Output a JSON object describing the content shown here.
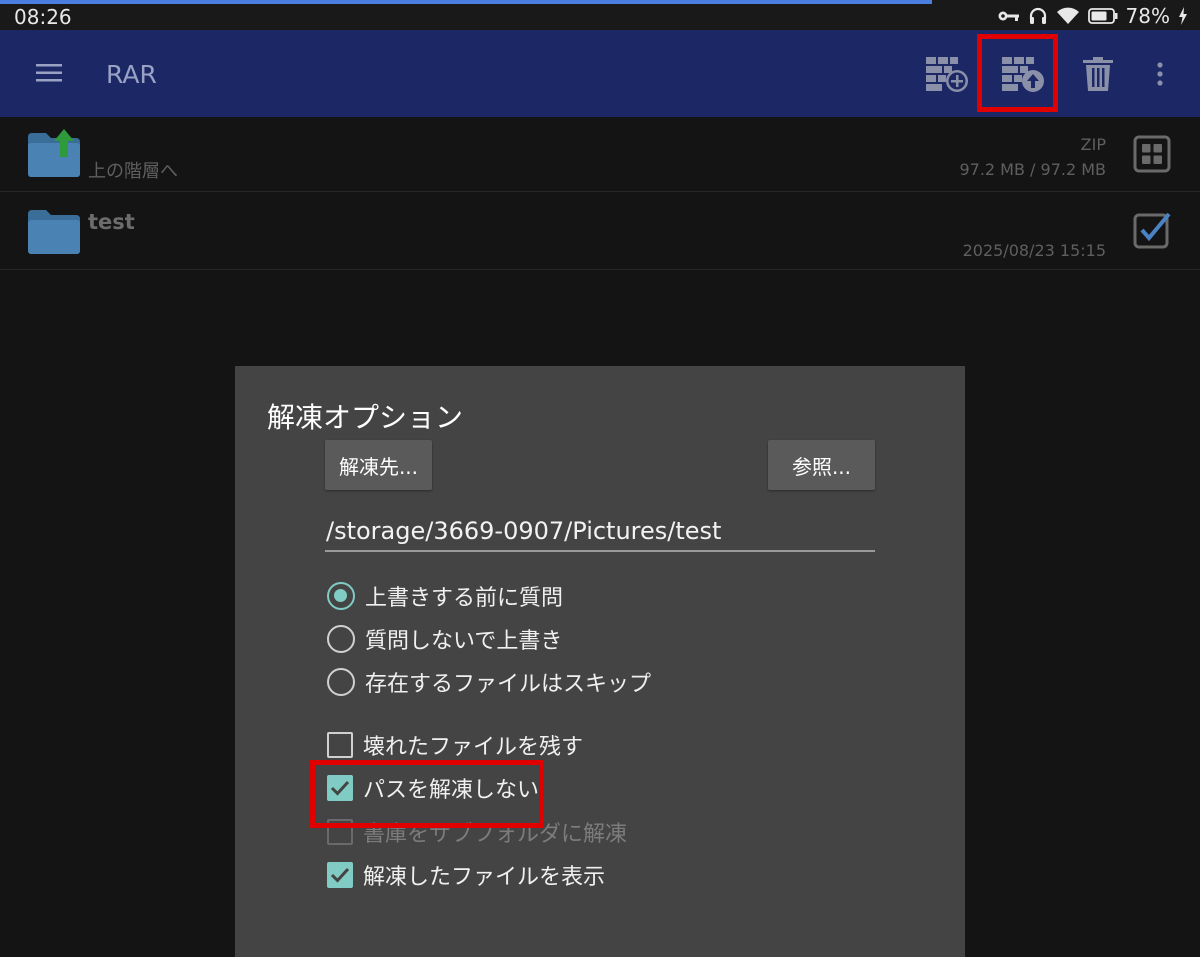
{
  "status_bar": {
    "time": "08:26",
    "battery": "78%"
  },
  "toolbar": {
    "title": "RAR"
  },
  "file_list": {
    "parent": {
      "label": "上の階層へ",
      "type": "ZIP",
      "size": "97.2 MB / 97.2 MB"
    },
    "items": [
      {
        "name": "test",
        "date": "2025/08/23 15:15",
        "checked": true
      }
    ]
  },
  "dialog": {
    "title": "解凍オプション",
    "dest_button": "解凍先...",
    "browse_button": "参照...",
    "path": "/storage/3669-0907/Pictures/test",
    "overwrite_options": [
      {
        "label": "上書きする前に質問",
        "selected": true
      },
      {
        "label": "質問しないで上書き",
        "selected": false
      },
      {
        "label": "存在するファイルはスキップ",
        "selected": false
      }
    ],
    "checkboxes": [
      {
        "label": "壊れたファイルを残す",
        "checked": false,
        "enabled": true
      },
      {
        "label": "パスを解凍しない",
        "checked": true,
        "enabled": true
      },
      {
        "label": "書庫をサブフォルダに解凍",
        "checked": false,
        "enabled": false
      },
      {
        "label": "解凍したファイルを表示",
        "checked": true,
        "enabled": true
      }
    ]
  },
  "colors": {
    "toolbar_bg": "#1c2766",
    "accent": "#80cbc4",
    "highlight": "#e00000",
    "dialog_bg": "#444444"
  }
}
